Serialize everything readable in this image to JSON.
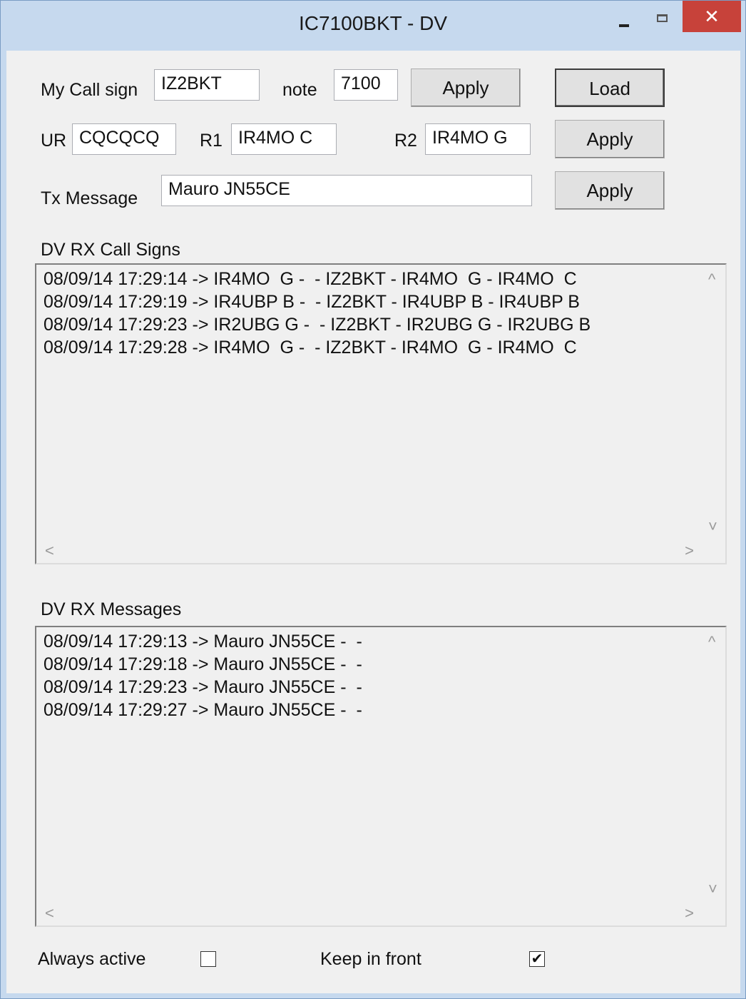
{
  "window": {
    "title": "IC7100BKT - DV"
  },
  "titlebar": {
    "minimize": "–",
    "close": "✕"
  },
  "row1": {
    "my_call_label": "My Call sign",
    "my_call_value": "IZ2BKT",
    "note_label": "note",
    "note_value": "7100",
    "apply_label": "Apply",
    "load_label": "Load"
  },
  "row2": {
    "ur_label": "UR",
    "ur_value": "CQCQCQ",
    "r1_label": "R1",
    "r1_value": "IR4MO  C",
    "r2_label": "R2",
    "r2_value": "IR4MO  G",
    "apply_label": "Apply"
  },
  "row3": {
    "tx_label": "Tx Message",
    "tx_value": "Mauro JN55CE",
    "apply_label": "Apply"
  },
  "callsigns": {
    "label": "DV RX Call Signs",
    "lines": [
      "08/09/14 17:29:14 -> IR4MO  G -  - IZ2BKT - IR4MO  G - IR4MO  C",
      "08/09/14 17:29:19 -> IR4UBP B -  - IZ2BKT - IR4UBP B - IR4UBP B",
      "08/09/14 17:29:23 -> IR2UBG G -  - IZ2BKT - IR2UBG G - IR2UBG B",
      "08/09/14 17:29:28 -> IR4MO  G -  - IZ2BKT - IR4MO  G - IR4MO  C"
    ]
  },
  "messages": {
    "label": "DV RX Messages",
    "lines": [
      "08/09/14 17:29:13 -> Mauro JN55CE -  -",
      "08/09/14 17:29:18 -> Mauro JN55CE -  -",
      "08/09/14 17:29:23 -> Mauro JN55CE -  -",
      "08/09/14 17:29:27 -> Mauro JN55CE -  -"
    ]
  },
  "scroll": {
    "up": "^",
    "down": "˅",
    "left": "<",
    "right": ">"
  },
  "footer": {
    "always_active_label": "Always active",
    "always_active_checked": false,
    "keep_front_label": "Keep in front",
    "keep_front_checked": true,
    "check_mark": "✔"
  }
}
